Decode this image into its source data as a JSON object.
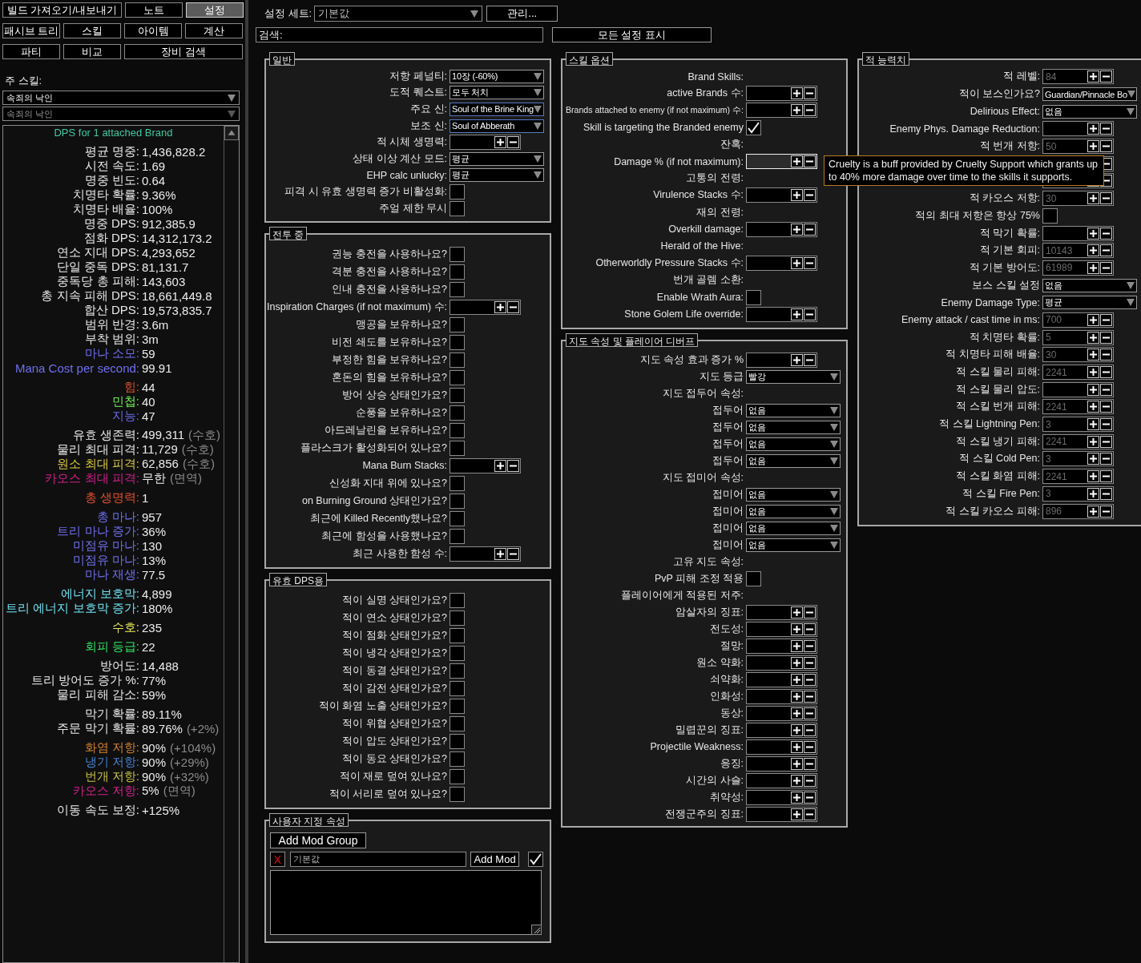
{
  "top_tabs": [
    [
      {
        "label": "빌드 가져오기/내보내기",
        "selected": false
      },
      {
        "label": "노트",
        "selected": false
      },
      {
        "label": "설정",
        "selected": true
      }
    ],
    [
      {
        "label": "패시브 트리",
        "selected": false
      },
      {
        "label": "스킬",
        "selected": false
      },
      {
        "label": "아이템",
        "selected": false
      },
      {
        "label": "계산",
        "selected": false
      }
    ],
    [
      {
        "label": "파티",
        "selected": false
      },
      {
        "label": "비교",
        "selected": false
      },
      {
        "label": "장비 검색",
        "selected": false
      }
    ]
  ],
  "main_skill": {
    "label": "주 스킬:",
    "dropdowns": [
      {
        "value": "속죄의 낙인",
        "disabled": false
      },
      {
        "value": "속죄의 낙인",
        "disabled": true
      }
    ]
  },
  "stats": {
    "header": "DPS for 1 attached Brand",
    "groups": [
      [
        {
          "label": "평균 명중:",
          "value": "1,436,828.2",
          "color": "#e8e8e8"
        },
        {
          "label": "시전 속도:",
          "value": "1.69",
          "color": "#e8e8e8"
        },
        {
          "label": "명중 빈도:",
          "value": "0.64",
          "color": "#e8e8e8"
        },
        {
          "label": "치명타 확률:",
          "value": "9.36%",
          "color": "#e8e8e8"
        },
        {
          "label": "치명타 배율:",
          "value": "100%",
          "color": "#e8e8e8"
        },
        {
          "label": "명중 DPS:",
          "value": "912,385.9",
          "color": "#e8e8e8"
        },
        {
          "label": "점화 DPS:",
          "value": "14,312,173.2",
          "color": "#e8e8e8"
        },
        {
          "label": "연소 지대 DPS:",
          "value": "4,293,652",
          "color": "#e8e8e8"
        },
        {
          "label": "단일 중독 DPS:",
          "value": "81,131.7",
          "color": "#e8e8e8"
        },
        {
          "label": "중독당 총 피해:",
          "value": "143,603",
          "color": "#e8e8e8"
        },
        {
          "label": "총 지속 피해 DPS:",
          "value": "18,661,449.8",
          "color": "#e8e8e8"
        },
        {
          "label": "합산 DPS:",
          "value": "19,573,835.7",
          "color": "#e8e8e8"
        },
        {
          "label": "범위 반경:",
          "value": "3.6m",
          "color": "#e8e8e8"
        },
        {
          "label": "부착 범위:",
          "value": "3m",
          "color": "#e8e8e8"
        },
        {
          "label": "마나 소모:",
          "value": "59",
          "color": "#7070f0"
        },
        {
          "label": "Mana Cost per second:",
          "value": "99.91",
          "color": "#7070f0"
        }
      ],
      [
        {
          "label": "힘:",
          "value": "44",
          "color": "#e0502c"
        },
        {
          "label": "민첩:",
          "value": "40",
          "color": "#70f050"
        },
        {
          "label": "지능:",
          "value": "47",
          "color": "#6868f0"
        }
      ],
      [
        {
          "label": "유효 생존력:",
          "value": "499,311",
          "note": "(수호)",
          "color": "#e8e8e8"
        },
        {
          "label": "물리 최대 피격:",
          "value": "11,729",
          "note": "(수호)",
          "color": "#e8e8e8"
        },
        {
          "label": "원소 최대 피격:",
          "value": "62,856",
          "note": "(수호)",
          "color": "#d8c840"
        },
        {
          "label": "카오스 최대 피격:",
          "value": "무한",
          "note": "(면역)",
          "color": "#d0208c"
        }
      ],
      [
        {
          "label": "총 생명력:",
          "value": "1",
          "color": "#e0502c"
        }
      ],
      [
        {
          "label": "총 마나:",
          "value": "957",
          "color": "#7070f0"
        },
        {
          "label": "트리 마나 증가:",
          "value": "36%",
          "color": "#7070f0"
        },
        {
          "label": "미점유 마나:",
          "value": "130",
          "color": "#7070f0"
        },
        {
          "label": "미점유 마나:",
          "value": "13%",
          "color": "#7070f0"
        },
        {
          "label": "마나 재생:",
          "value": "77.5",
          "color": "#7070f0"
        }
      ],
      [
        {
          "label": "에너지 보호막:",
          "value": "4,899",
          "color": "#70e0f0"
        },
        {
          "label": "트리 에너지 보호막 증가:",
          "value": "180%",
          "color": "#70e0f0"
        }
      ],
      [
        {
          "label": "수호:",
          "value": "235",
          "color": "#e8e858"
        }
      ],
      [
        {
          "label": "회피 등급:",
          "value": "22",
          "color": "#30e060"
        }
      ],
      [
        {
          "label": "방어도:",
          "value": "14,488",
          "color": "#e8e8e8"
        },
        {
          "label": "트리 방어도 증가 %:",
          "value": "77%",
          "color": "#e8e8e8"
        },
        {
          "label": "물리 피해 감소:",
          "value": "59%",
          "color": "#e8e8e8"
        }
      ],
      [
        {
          "label": "막기 확률:",
          "value": "89.11%",
          "color": "#e8e8e8"
        },
        {
          "label": "주문 막기 확률:",
          "value": "89.76%",
          "note": "(+2%)",
          "color": "#e8e8e8"
        }
      ],
      [
        {
          "label": "화염 저항:",
          "value": "90%",
          "note": "(+104%)",
          "color": "#d08030"
        },
        {
          "label": "냉기 저항:",
          "value": "90%",
          "note": "(+29%)",
          "color": "#4880d0"
        },
        {
          "label": "번개 저항:",
          "value": "90%",
          "note": "(+32%)",
          "color": "#c8c040"
        },
        {
          "label": "카오스 저항:",
          "value": "5%",
          "note": "(면역)",
          "color": "#d0208c"
        }
      ],
      [
        {
          "label": "이동 속도 보정:",
          "value": "+125%",
          "color": "#e8e8e8"
        }
      ]
    ]
  },
  "config_set": {
    "label": "설정 세트:",
    "value": "기본값",
    "manage": "관리..."
  },
  "search": {
    "label": "검색:"
  },
  "show_all": "모든 설정 표시",
  "columns": [
    [
      {
        "title": "일반",
        "kind": "options",
        "rows": [
          {
            "kind": "dropdown",
            "label": "저항 페널티:",
            "value": "10장 (-60%)",
            "highlighted": false
          },
          {
            "kind": "dropdown",
            "label": "도적 퀘스트:",
            "value": "모두 처치",
            "highlighted": false
          },
          {
            "kind": "dropdown",
            "label": "주요 신:",
            "value": "Soul of the Brine King",
            "highlighted": true
          },
          {
            "kind": "dropdown",
            "label": "보조 신:",
            "value": "Soul of Abberath",
            "highlighted": true
          },
          {
            "kind": "spin",
            "label": "적 시체 생명력:"
          },
          {
            "kind": "dropdown",
            "label": "상태 이상 계산 모드:",
            "value": "평균",
            "highlighted": false
          },
          {
            "kind": "dropdown",
            "label": "EHP calc unlucky:",
            "value": "평균",
            "highlighted": false
          },
          {
            "kind": "check",
            "label": "피격 시 유효 생명력 증가 비활성화:",
            "checked": false
          },
          {
            "kind": "check",
            "label": "주얼 제한 무시",
            "checked": false
          }
        ]
      },
      {
        "title": "전투 중",
        "kind": "options",
        "rows": [
          {
            "kind": "check",
            "label": "권능 충전을 사용하나요?",
            "checked": false
          },
          {
            "kind": "check",
            "label": "격분 충전을 사용하나요?",
            "checked": false
          },
          {
            "kind": "check",
            "label": "인내 충전을 사용하나요?",
            "checked": false
          },
          {
            "kind": "spin",
            "label": "Inspiration Charges (if not maximum) 수:"
          },
          {
            "kind": "check",
            "label": "맹공을 보유하나요?",
            "checked": false
          },
          {
            "kind": "check",
            "label": "비전 쇄도를 보유하나요?",
            "checked": false
          },
          {
            "kind": "check",
            "label": "부정한 힘을 보유하나요?",
            "checked": false
          },
          {
            "kind": "check",
            "label": "혼돈의 힘을 보유하나요?",
            "checked": false
          },
          {
            "kind": "check",
            "label": "방어 상승 상태인가요?",
            "checked": false
          },
          {
            "kind": "check",
            "label": "순풍을 보유하나요?",
            "checked": false
          },
          {
            "kind": "check",
            "label": "아드레날린을 보유하나요?",
            "checked": false
          },
          {
            "kind": "check",
            "label": "플라스크가 활성화되어 있나요?",
            "checked": false
          },
          {
            "kind": "spin",
            "label": "Mana Burn Stacks:"
          },
          {
            "kind": "check",
            "label": "신성화 지대 위에 있나요?",
            "checked": false
          },
          {
            "kind": "check",
            "label": "on Burning Ground 상태인가요?",
            "checked": false
          },
          {
            "kind": "check",
            "label": "최근에 Killed Recently했나요?",
            "checked": false
          },
          {
            "kind": "check",
            "label": "최근에 함성을 사용했나요?",
            "checked": false
          },
          {
            "kind": "spin",
            "label": "최근 사용한 함성 수:"
          }
        ]
      },
      {
        "title": "유효 DPS용",
        "kind": "options",
        "rows": [
          {
            "kind": "check",
            "label": "적이 실명 상태인가요?",
            "checked": false
          },
          {
            "kind": "check",
            "label": "적이 연소 상태인가요?",
            "checked": false
          },
          {
            "kind": "check",
            "label": "적이 점화 상태인가요?",
            "checked": false
          },
          {
            "kind": "check",
            "label": "적이 냉각 상태인가요?",
            "checked": false
          },
          {
            "kind": "check",
            "label": "적이 동결 상태인가요?",
            "checked": false
          },
          {
            "kind": "check",
            "label": "적이 감전 상태인가요?",
            "checked": false
          },
          {
            "kind": "check",
            "label": "적이 화염 노출 상태인가요?",
            "checked": false
          },
          {
            "kind": "check",
            "label": "적이 위협 상태인가요?",
            "checked": false
          },
          {
            "kind": "check",
            "label": "적이 압도 상태인가요?",
            "checked": false
          },
          {
            "kind": "check",
            "label": "적이 동요 상태인가요?",
            "checked": false
          },
          {
            "kind": "check",
            "label": "적이 재로 덮여 있나요?",
            "checked": false
          },
          {
            "kind": "check",
            "label": "적이 서리로 덮여 있나요?",
            "checked": false
          }
        ]
      },
      {
        "title": "사용자 지정 속성",
        "kind": "custom",
        "add_group": "Add Mod Group",
        "remove": "X",
        "name_value": "기본값",
        "add_mod": "Add Mod",
        "enabled": true
      }
    ],
    [
      {
        "title": "스킬 옵션",
        "kind": "options",
        "rows": [
          {
            "kind": "heading",
            "label": "Brand Skills:"
          },
          {
            "kind": "spin",
            "label": "active Brands 수:",
            "focused": false
          },
          {
            "kind": "spin",
            "label": "Brands attached to enemy (if not maximum) 수:",
            "focused": false
          },
          {
            "kind": "check",
            "label": "Skill is targeting the Branded enemy",
            "checked": true
          },
          {
            "kind": "heading",
            "label": "잔혹:"
          },
          {
            "kind": "spin",
            "label": "Damage % (if not maximum):",
            "focused": true
          },
          {
            "kind": "heading",
            "label": "고통의 전령:"
          },
          {
            "kind": "spin",
            "label": "Virulence Stacks 수:",
            "focused": false
          },
          {
            "kind": "heading",
            "label": "재의 전령:"
          },
          {
            "kind": "spin",
            "label": "Overkill damage:",
            "focused": false
          },
          {
            "kind": "heading",
            "label": "Herald of the Hive:"
          },
          {
            "kind": "spin",
            "label": "Otherworldly Pressure Stacks 수:",
            "focused": false
          },
          {
            "kind": "heading",
            "label": "번개 골렘 소환:"
          },
          {
            "kind": "check",
            "label": "Enable Wrath Aura:",
            "checked": false
          },
          {
            "kind": "spin",
            "label": "Stone Golem Life override:",
            "focused": false
          }
        ]
      },
      {
        "title": "지도 속성 및 플레이어 디버프",
        "kind": "options",
        "rows": [
          {
            "kind": "spin",
            "label": "지도 속성 효과 증가 %"
          },
          {
            "kind": "dropdown",
            "label": "지도 등급",
            "value": "빨강"
          },
          {
            "kind": "heading",
            "label": "지도 접두어 속성:"
          },
          {
            "kind": "dropdown",
            "label": "접두어",
            "value": "없음"
          },
          {
            "kind": "dropdown",
            "label": "접두어",
            "value": "없음"
          },
          {
            "kind": "dropdown",
            "label": "접두어",
            "value": "없음"
          },
          {
            "kind": "dropdown",
            "label": "접두어",
            "value": "없음"
          },
          {
            "kind": "heading",
            "label": "지도 접미어 속성:"
          },
          {
            "kind": "dropdown",
            "label": "접미어",
            "value": "없음"
          },
          {
            "kind": "dropdown",
            "label": "접미어",
            "value": "없음"
          },
          {
            "kind": "dropdown",
            "label": "접미어",
            "value": "없음"
          },
          {
            "kind": "dropdown",
            "label": "접미어",
            "value": "없음"
          },
          {
            "kind": "heading",
            "label": "고유 지도 속성:"
          },
          {
            "kind": "check",
            "label": "PvP 피해 조정 적용",
            "checked": false
          },
          {
            "kind": "heading",
            "label": "플레이어에게 적용된 저주:"
          },
          {
            "kind": "spin",
            "label": "암살자의 징표:"
          },
          {
            "kind": "spin",
            "label": "전도성:"
          },
          {
            "kind": "spin",
            "label": "절망:"
          },
          {
            "kind": "spin",
            "label": "원소 약화:"
          },
          {
            "kind": "spin",
            "label": "쇠약화:"
          },
          {
            "kind": "spin",
            "label": "인화성:"
          },
          {
            "kind": "spin",
            "label": "동상:"
          },
          {
            "kind": "spin",
            "label": "밀렵꾼의 징표:"
          },
          {
            "kind": "spin",
            "label": "Projectile Weakness:"
          },
          {
            "kind": "spin",
            "label": "응징:"
          },
          {
            "kind": "spin",
            "label": "시간의 사슬:"
          },
          {
            "kind": "spin",
            "label": "취약성:"
          },
          {
            "kind": "spin",
            "label": "전쟁군주의 징표:"
          }
        ]
      }
    ],
    [
      {
        "title": "적 능력치",
        "kind": "options",
        "rows": [
          {
            "kind": "spin",
            "label": "적 레벨:",
            "placeholder": "84"
          },
          {
            "kind": "dropdown",
            "label": "적이 보스인가요?",
            "value": "Guardian/Pinnacle Bo"
          },
          {
            "kind": "dropdown",
            "label": "Delirious Effect:",
            "value": "없음"
          },
          {
            "kind": "spin",
            "label": "Enemy Phys. Damage Reduction:"
          },
          {
            "kind": "spin",
            "label": "적 번개 저항:",
            "placeholder": "50"
          },
          {
            "kind": "spin"
          },
          {
            "kind": "spin"
          },
          {
            "kind": "spin",
            "label": "적 카오스 저항:",
            "placeholder": "30"
          },
          {
            "kind": "check",
            "label": "적의 최대 저항은 항상 75%",
            "checked": false
          },
          {
            "kind": "spin",
            "label": "적 막기 확률:"
          },
          {
            "kind": "spin",
            "label": "적 기본 회피:",
            "placeholder": "10143"
          },
          {
            "kind": "spin",
            "label": "적 기본 방어도:",
            "placeholder": "61989"
          },
          {
            "kind": "dropdown",
            "label": "보스 스킬 설정",
            "value": "없음"
          },
          {
            "kind": "dropdown",
            "label": "Enemy Damage Type:",
            "value": "평균"
          },
          {
            "kind": "spin",
            "label": "Enemy attack / cast time in ms:",
            "placeholder": "700"
          },
          {
            "kind": "spin",
            "label": "적 치명타 확률:",
            "placeholder": "5"
          },
          {
            "kind": "spin",
            "label": "적 치명타 피해 배율:",
            "placeholder": "30"
          },
          {
            "kind": "spin",
            "label": "적 스킬 물리 피해:",
            "placeholder": "2241"
          },
          {
            "kind": "spin",
            "label": "적 스킬 물리 압도:"
          },
          {
            "kind": "spin",
            "label": "적 스킬 번개 피해:",
            "placeholder": "2241"
          },
          {
            "kind": "spin",
            "label": "적 스킬 Lightning Pen:",
            "placeholder": "3"
          },
          {
            "kind": "spin",
            "label": "적 스킬 냉기 피해:",
            "placeholder": "2241"
          },
          {
            "kind": "spin",
            "label": "적 스킬 Cold Pen:",
            "placeholder": "3"
          },
          {
            "kind": "spin",
            "label": "적 스킬 화염 피해:",
            "placeholder": "2241"
          },
          {
            "kind": "spin",
            "label": "적 스킬 Fire Pen:",
            "placeholder": "3"
          },
          {
            "kind": "spin",
            "label": "적 스킬 카오스 피해:",
            "placeholder": "896"
          }
        ]
      }
    ]
  ],
  "tooltip": {
    "text": "Cruelty is a buff provided by Cruelty Support which grants up to 40% more damage over time to the skills it supports."
  }
}
